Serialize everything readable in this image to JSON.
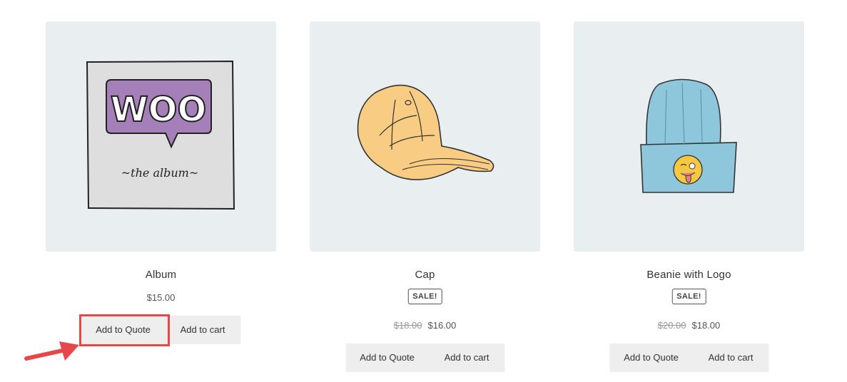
{
  "products": [
    {
      "title": "Album",
      "price": "$15.00",
      "image_icon": "woo-album-illustration",
      "image_text": "WOO",
      "image_subtext": "~the  album~",
      "add_to_quote": "Add to Quote",
      "add_to_cart": "Add to cart"
    },
    {
      "title": "Cap",
      "sale_badge": "SALE!",
      "old_price": "$18.00",
      "price": "$16.00",
      "image_icon": "cap-illustration",
      "add_to_quote": "Add to Quote",
      "add_to_cart": "Add to cart"
    },
    {
      "title": "Beanie with Logo",
      "sale_badge": "SALE!",
      "old_price": "$20.00",
      "price": "$18.00",
      "image_icon": "beanie-illustration",
      "add_to_quote": "Add to Quote",
      "add_to_cart": "Add to cart"
    }
  ],
  "annotation": {
    "highlight_color": "#e8474a",
    "arrow_icon": "red-arrow-icon"
  },
  "colors": {
    "image_bg": "#e9eef1",
    "button_bg": "#eeeeee"
  }
}
